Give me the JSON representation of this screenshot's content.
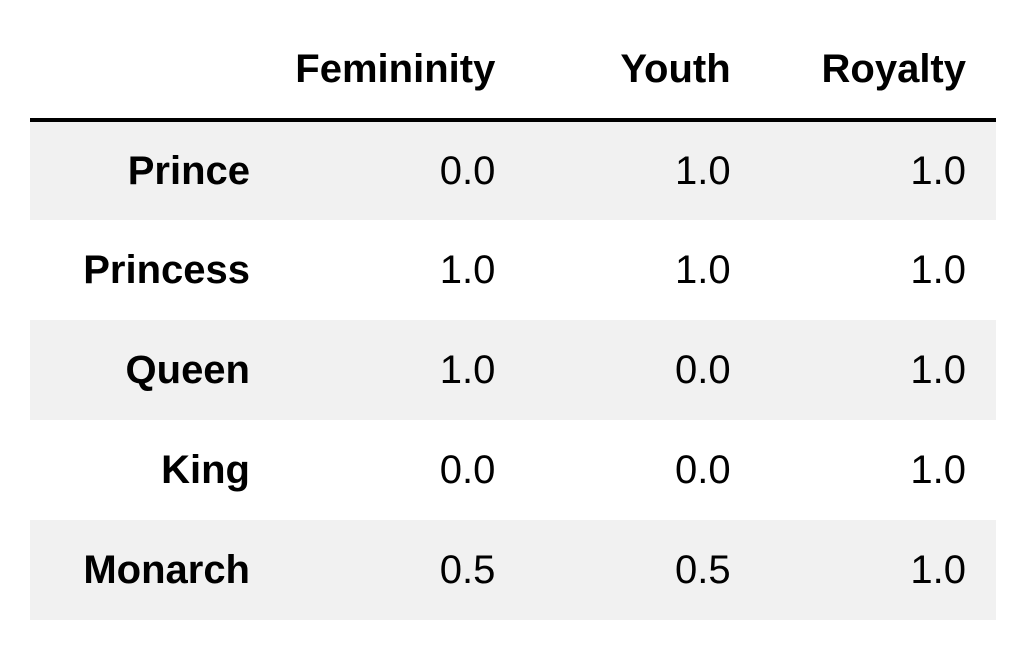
{
  "chart_data": {
    "type": "table",
    "title": "",
    "columns": [
      "Femininity",
      "Youth",
      "Royalty"
    ],
    "rows": [
      {
        "label": "Prince",
        "values": [
          "0.0",
          "1.0",
          "1.0"
        ]
      },
      {
        "label": "Princess",
        "values": [
          "1.0",
          "1.0",
          "1.0"
        ]
      },
      {
        "label": "Queen",
        "values": [
          "1.0",
          "0.0",
          "1.0"
        ]
      },
      {
        "label": "King",
        "values": [
          "0.0",
          "0.0",
          "1.0"
        ]
      },
      {
        "label": "Monarch",
        "values": [
          "0.5",
          "0.5",
          "1.0"
        ]
      }
    ]
  }
}
